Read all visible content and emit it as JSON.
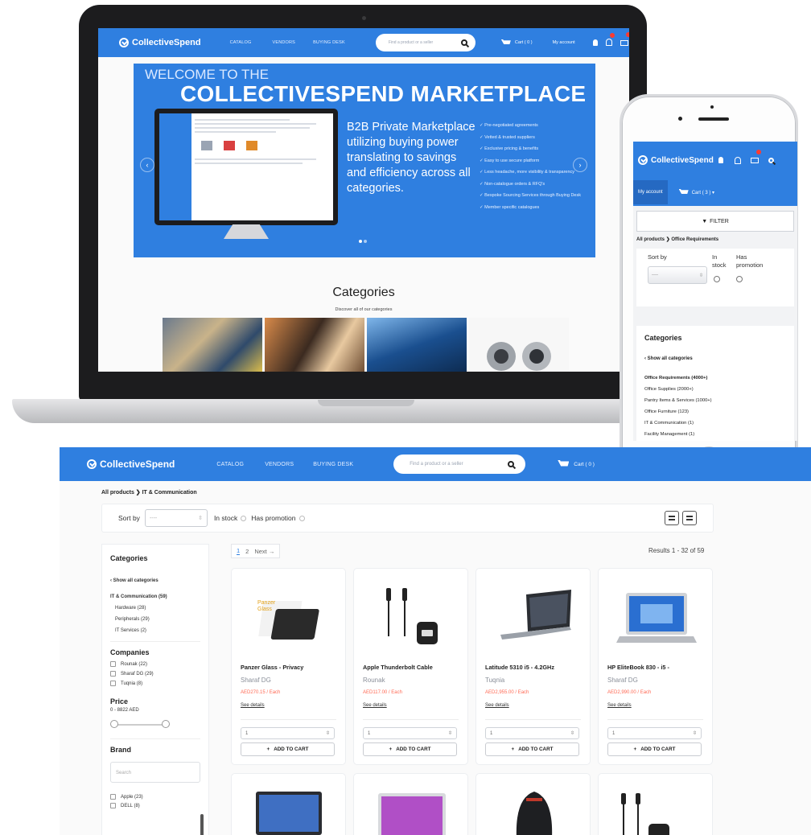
{
  "brand": "CollectiveSpend",
  "nav": {
    "catalog": "CATALOG",
    "vendors": "VENDORS",
    "buying_desk": "BUYING DESK",
    "search_placeholder": "Find a product or a seller",
    "cart_laptop": "Cart ( 0 )",
    "cart_store": "Cart ( 0 )",
    "my_account": "My account"
  },
  "hero": {
    "welcome": "WELCOME TO THE",
    "title": "COLLECTIVESPEND MARKETPLACE",
    "text": "B2B Private Marketplace utilizing buying power translating to savings and efficiency across all categories.",
    "features": [
      "Pre-negotiated agreements",
      "Vetted & trusted suppliers",
      "Exclusive pricing & benefits",
      "Easy to use secure platform",
      "Less headache, more visibility & transparency",
      "Non-catalogue orders & RFQ's",
      "Bespoke Sourcing Services through Buying Desk",
      "Member specific catalogues"
    ]
  },
  "categories_section": {
    "title": "Categories",
    "subtitle": "Discover all of our categories"
  },
  "phone": {
    "my_account": "My account",
    "cart": "Cart ( 3 ) ▾",
    "filter": "FILTER",
    "crumb_root": "All products",
    "crumb_current": "Office Requirements",
    "sort_by": "Sort by",
    "sort_value": "----",
    "in_stock": "In stock",
    "has_promotion": "Has promotion",
    "categories_title": "Categories",
    "show_all": "Show all categories",
    "category_items": [
      "Office Requirements (4000+)",
      "Office Supplies (2000+)",
      "Pantry Items & Services (1000+)",
      "Office Furniture (123)",
      "IT & Communication (1)",
      "Facility Management (1)"
    ]
  },
  "store": {
    "crumb_root": "All products",
    "crumb_current": "IT & Communication",
    "sort_by": "Sort by",
    "sort_value": "----",
    "in_stock": "In stock",
    "has_promotion": "Has promotion",
    "pager": {
      "p1": "1",
      "p2": "2",
      "next": "Next →"
    },
    "results": "Results 1 - 32 of 59",
    "sidebar": {
      "categories_title": "Categories",
      "show_all": "Show all categories",
      "current_category": "IT & Communication (59)",
      "subcategories": [
        "Hardware (28)",
        "Peripherals (29)",
        "IT Services (2)"
      ],
      "companies_title": "Companies",
      "companies": [
        "Rounak (22)",
        "Sharaf DG (29)",
        "Tuqnia (8)"
      ],
      "price_title": "Price",
      "price_range": "0 - 8822 AED",
      "brand_title": "Brand",
      "brand_search": "Search",
      "brands": [
        "Apple (23)",
        "DELL (8)"
      ]
    },
    "products": [
      {
        "name": "Panzer Glass - Privacy",
        "vendor": "Sharaf DG",
        "price": "AED270.15 / Each",
        "link": "See details",
        "qty": "1",
        "button": "ADD TO CART"
      },
      {
        "name": "Apple Thunderbolt Cable",
        "vendor": "Rounak",
        "price": "AED117.00 / Each",
        "link": "See details",
        "qty": "1",
        "button": "ADD TO CART"
      },
      {
        "name": "Latitude 5310 i5 - 4.2GHz",
        "vendor": "Tuqnia",
        "price": "AED2,955.00 / Each",
        "link": "See details",
        "qty": "1",
        "button": "ADD TO CART"
      },
      {
        "name": "HP EliteBook 830 - i5 -",
        "vendor": "Sharaf DG",
        "price": "AED2,990.00 / Each",
        "link": "See details",
        "qty": "1",
        "button": "ADD TO CART"
      }
    ]
  },
  "colors": {
    "primary": "#2f7fe0",
    "price": "#ff6a55",
    "badge": "#ff3b30"
  }
}
